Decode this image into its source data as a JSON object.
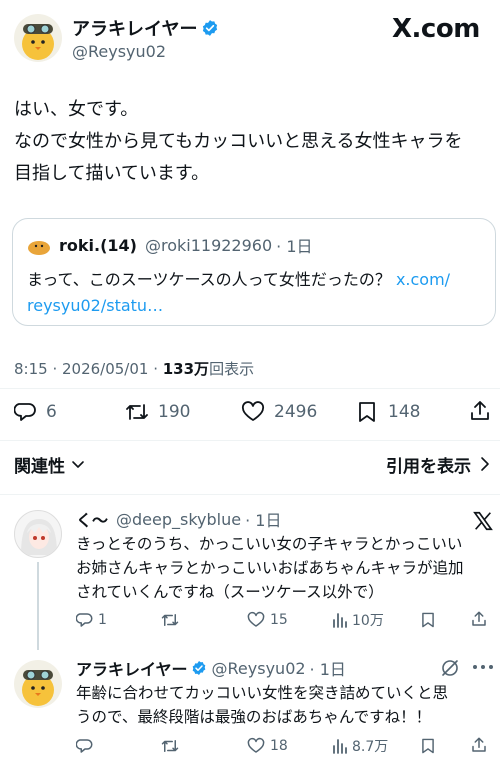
{
  "header": {
    "display_name": "アラキレイヤー",
    "handle": "@Reysyu02",
    "brand": "X.com"
  },
  "tweet": {
    "lines": [
      "はい、女です。",
      "なので女性から見てもカッコいいと思える女性キャラを",
      "目指して描いています。"
    ],
    "quote": {
      "name": "roki.(14)",
      "handle": "@roki11922960",
      "time": "· 1日",
      "text_line1": "まって、このスーツケースの人って女性だったの？",
      "link1": "x.com/",
      "link2": "reysyu02/statu…"
    },
    "meta_time": "8:15 · 2026/05/01 · ",
    "meta_views": "133万",
    "meta_views_label": "回表示"
  },
  "stats": {
    "replies": "6",
    "retweets": "190",
    "likes": "2496",
    "bookmarks": "148"
  },
  "sort": {
    "relevance_label": "関連性",
    "quotes_label": "引用を表示"
  },
  "replies": [
    {
      "name": "く〜",
      "handle": "@deep_skyblue",
      "time": "· 1日",
      "lines": [
        "きっとそのうち、かっこいい女の子キャラとかっこいい",
        "お姉さんキャラとかっこいいおばあちゃんキャラが追加",
        "されていくんですね（スーツケース以外で）"
      ],
      "reply_count": "1",
      "retweet_count": "",
      "like_count": "15",
      "view_count": "10万"
    },
    {
      "name": "アラキレイヤー",
      "handle": "@Reysyu02",
      "time": "· 1日",
      "lines": [
        "年齢に合わせてカッコいい女性を突き詰めていくと思",
        "うので、最終段階は最強のおばあちゃんですね！！"
      ],
      "reply_count": "",
      "retweet_count": "",
      "like_count": "18",
      "view_count": "8.7万"
    }
  ],
  "colors": {
    "text": "#0f1419",
    "muted": "#536471",
    "link": "#1d9bf0",
    "verified": "#1d9bf0",
    "border": "#cfd9de"
  }
}
